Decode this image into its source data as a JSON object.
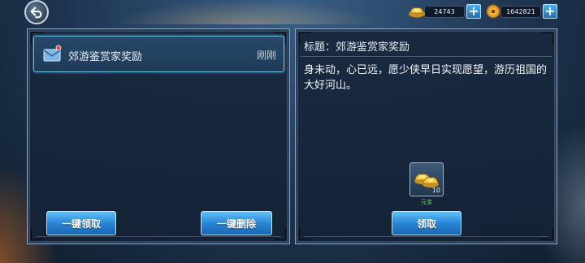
{
  "header": {
    "back_icon": "back-arrow-icon",
    "gold_ingot_amount": "24743",
    "copper_coin_amount": "1642821",
    "plus_label": "+"
  },
  "mail_list": {
    "items": [
      {
        "title": "郊游鉴赏家奖励",
        "time": "刚刚",
        "icon": "mail-envelope-icon"
      }
    ],
    "claim_all_label": "一键领取",
    "delete_all_label": "一键删除"
  },
  "mail_detail": {
    "title_line": "标题：郊游鉴赏家奖励",
    "body": "身未动，心已远，愿少侠早日实现愿望，游历祖国的大好河山。",
    "reward": {
      "name": "元宝",
      "count": "10",
      "icon": "gold-ingot-icon"
    },
    "claim_label": "领取"
  },
  "colors": {
    "button_blue": "#2a86d6",
    "selected_border": "#6cc2e8",
    "reward_label_green": "#6bd36b"
  }
}
